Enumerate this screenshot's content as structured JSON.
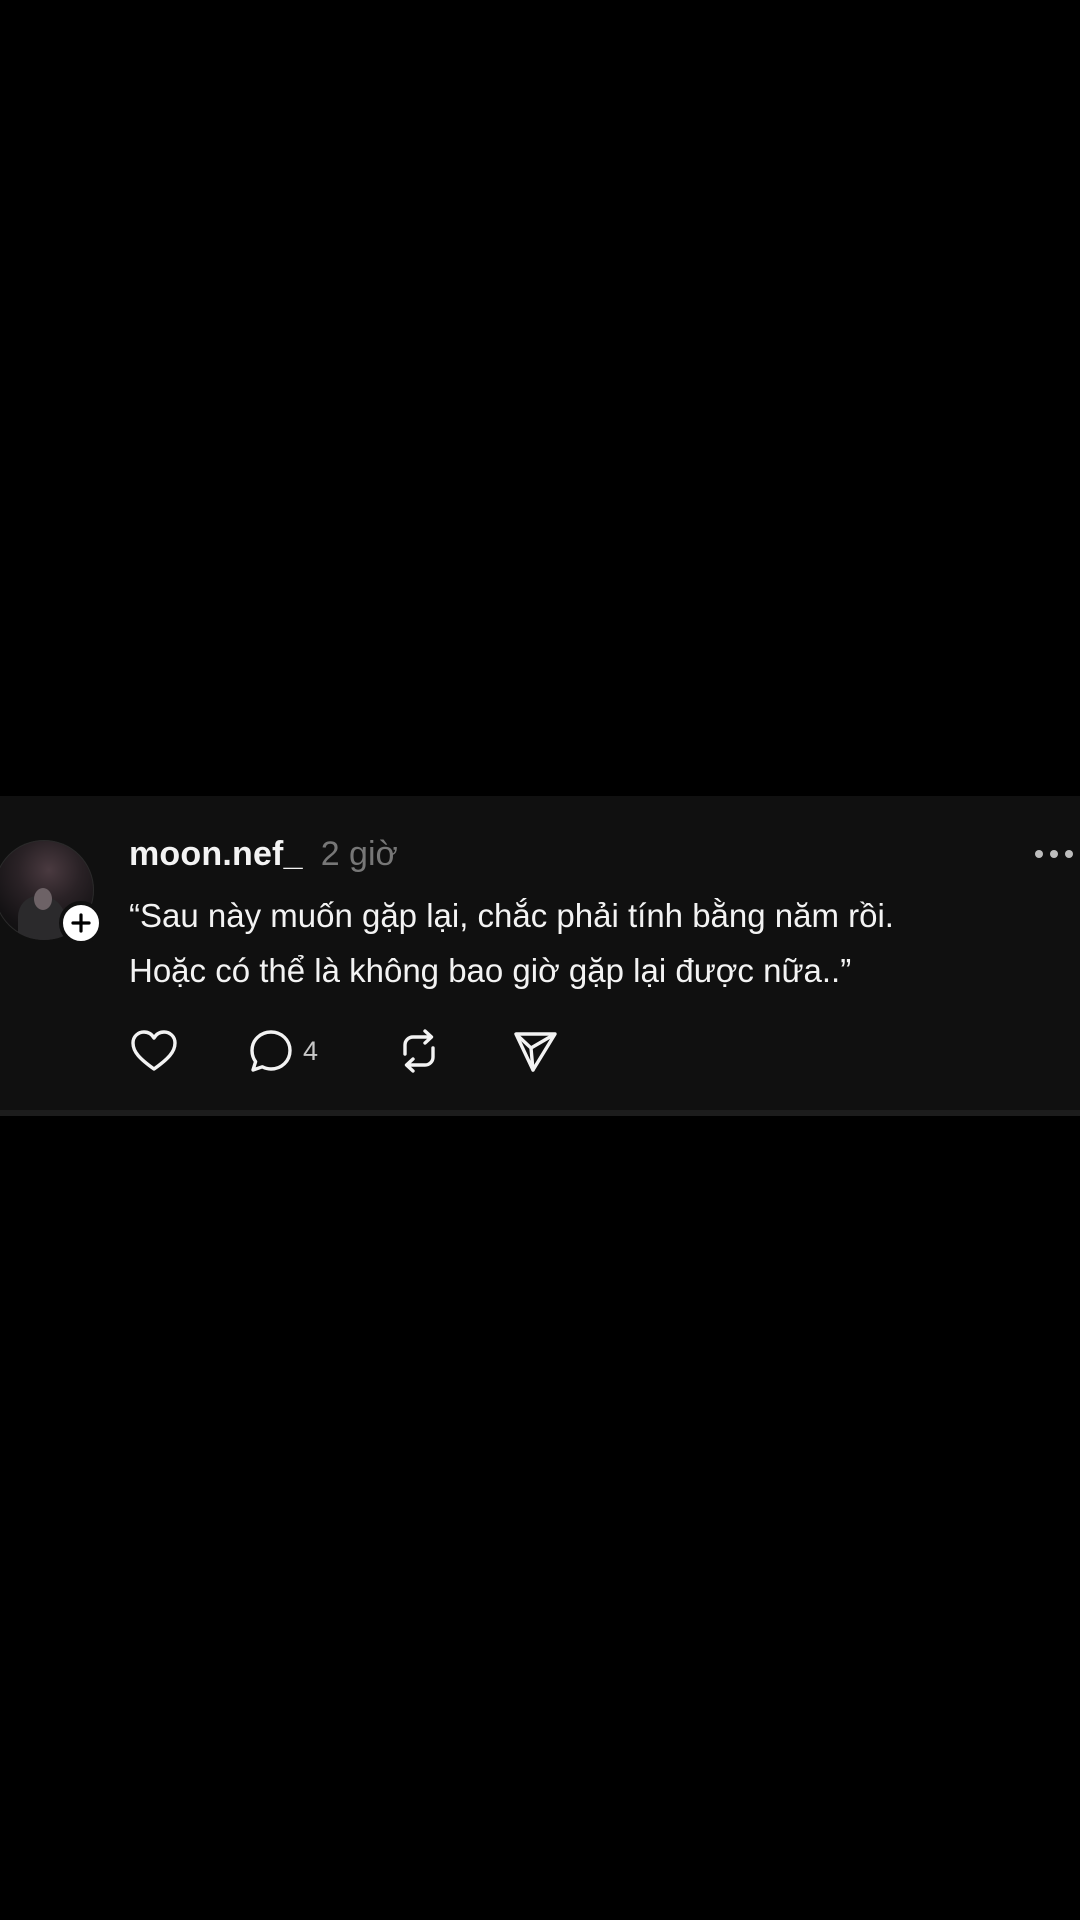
{
  "post": {
    "username": "moon.nef_",
    "timestamp": "2 giờ",
    "text": "“Sau này muốn gặp lại, chắc phải tính bằng năm rồi.\nHoặc có thể là không bao giờ gặp lại được nữa..”",
    "reply_count": "4"
  },
  "icons": {
    "avatar": "user-avatar-photo",
    "follow": "plus-icon",
    "more": "more-icon",
    "like": "heart-icon",
    "reply": "comment-icon",
    "repost": "repost-icon",
    "share": "send-icon"
  },
  "colors": {
    "background": "#000000",
    "card": "#101010",
    "text": "#f3f3f3",
    "muted": "#777777"
  }
}
